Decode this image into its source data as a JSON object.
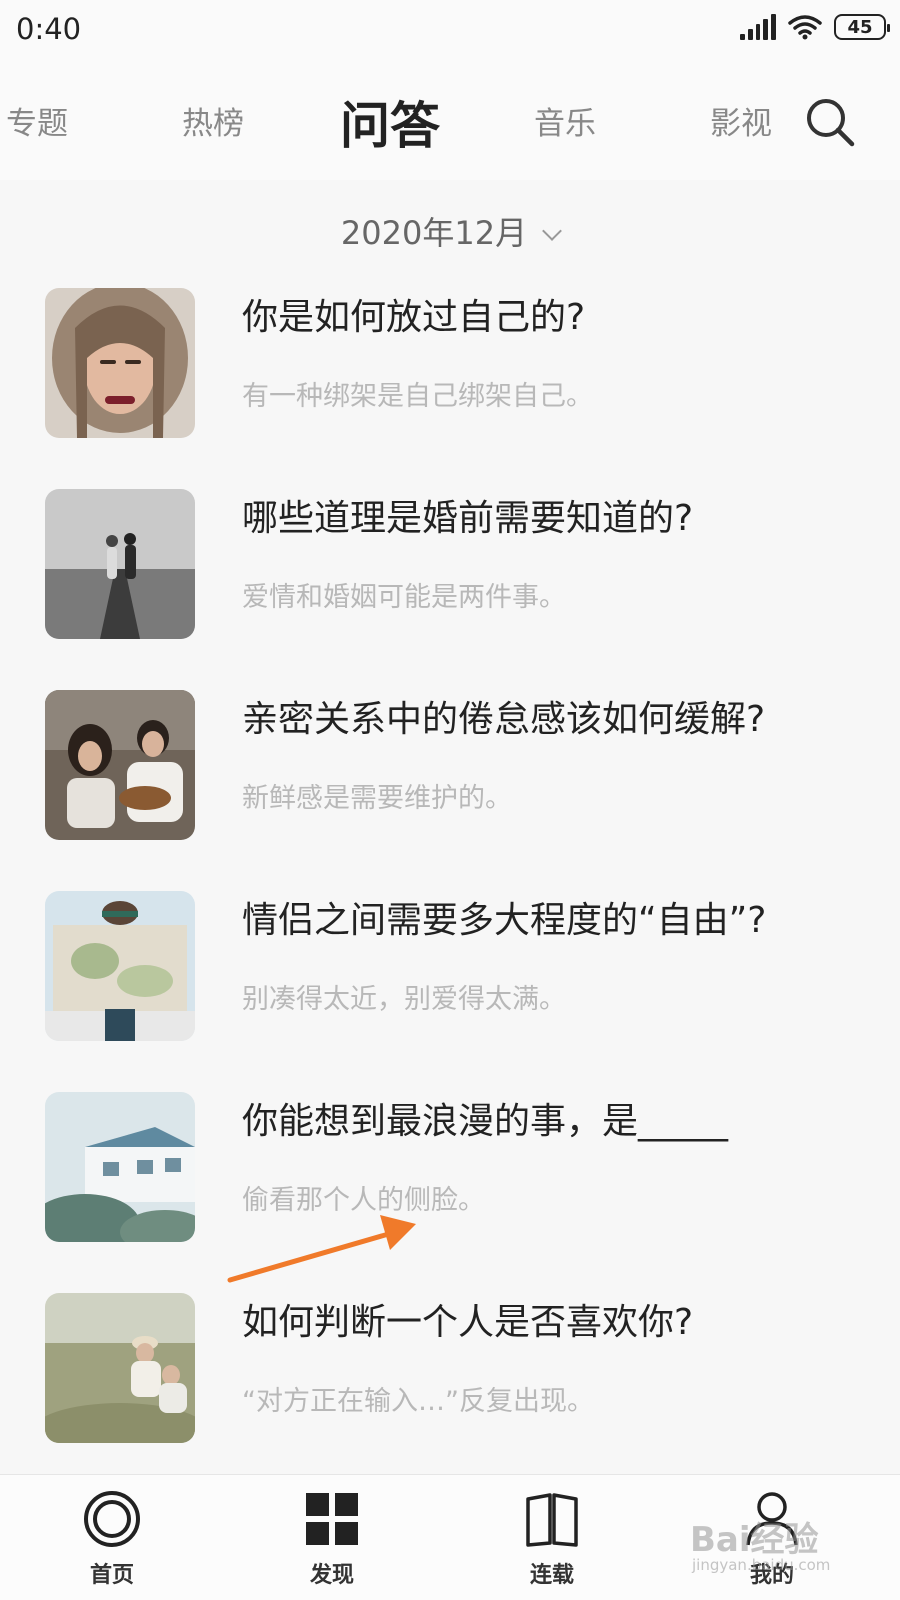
{
  "status": {
    "time": "0:40",
    "battery": "45"
  },
  "nav": {
    "tabs": [
      {
        "label": "专题",
        "active": false
      },
      {
        "label": "热榜",
        "active": false
      },
      {
        "label": "问答",
        "active": true
      },
      {
        "label": "音乐",
        "active": false
      },
      {
        "label": "影视",
        "active": false
      }
    ],
    "search_icon": "search-icon"
  },
  "date": {
    "label": "2020年12月"
  },
  "articles": [
    {
      "title": "你是如何放过自己的?",
      "subtitle": "有一种绑架是自己绑架自己。"
    },
    {
      "title": "哪些道理是婚前需要知道的?",
      "subtitle": "爱情和婚姻可能是两件事。"
    },
    {
      "title": "亲密关系中的倦怠感该如何缓解?",
      "subtitle": "新鲜感是需要维护的。"
    },
    {
      "title": "情侣之间需要多大程度的“自由”?",
      "subtitle": "别凑得太近，别爱得太满。"
    },
    {
      "title": "你能想到最浪漫的事，是_____",
      "subtitle": "偷看那个人的侧脸。"
    },
    {
      "title": "如何判断一个人是否喜欢你?",
      "subtitle": "“对方正在输入…”反复出现。"
    }
  ],
  "bottom_nav": [
    {
      "label": "首页",
      "icon": "home-ring-icon"
    },
    {
      "label": "发现",
      "icon": "grid-icon"
    },
    {
      "label": "连载",
      "icon": "book-icon"
    },
    {
      "label": "我的",
      "icon": "profile-icon"
    }
  ],
  "watermark": {
    "text": "Bai经验",
    "sub": "jingyan.baidu.com"
  },
  "colors": {
    "accent_arrow": "#f07a2a",
    "text_primary": "#222222",
    "text_muted": "#b8b8b8"
  }
}
